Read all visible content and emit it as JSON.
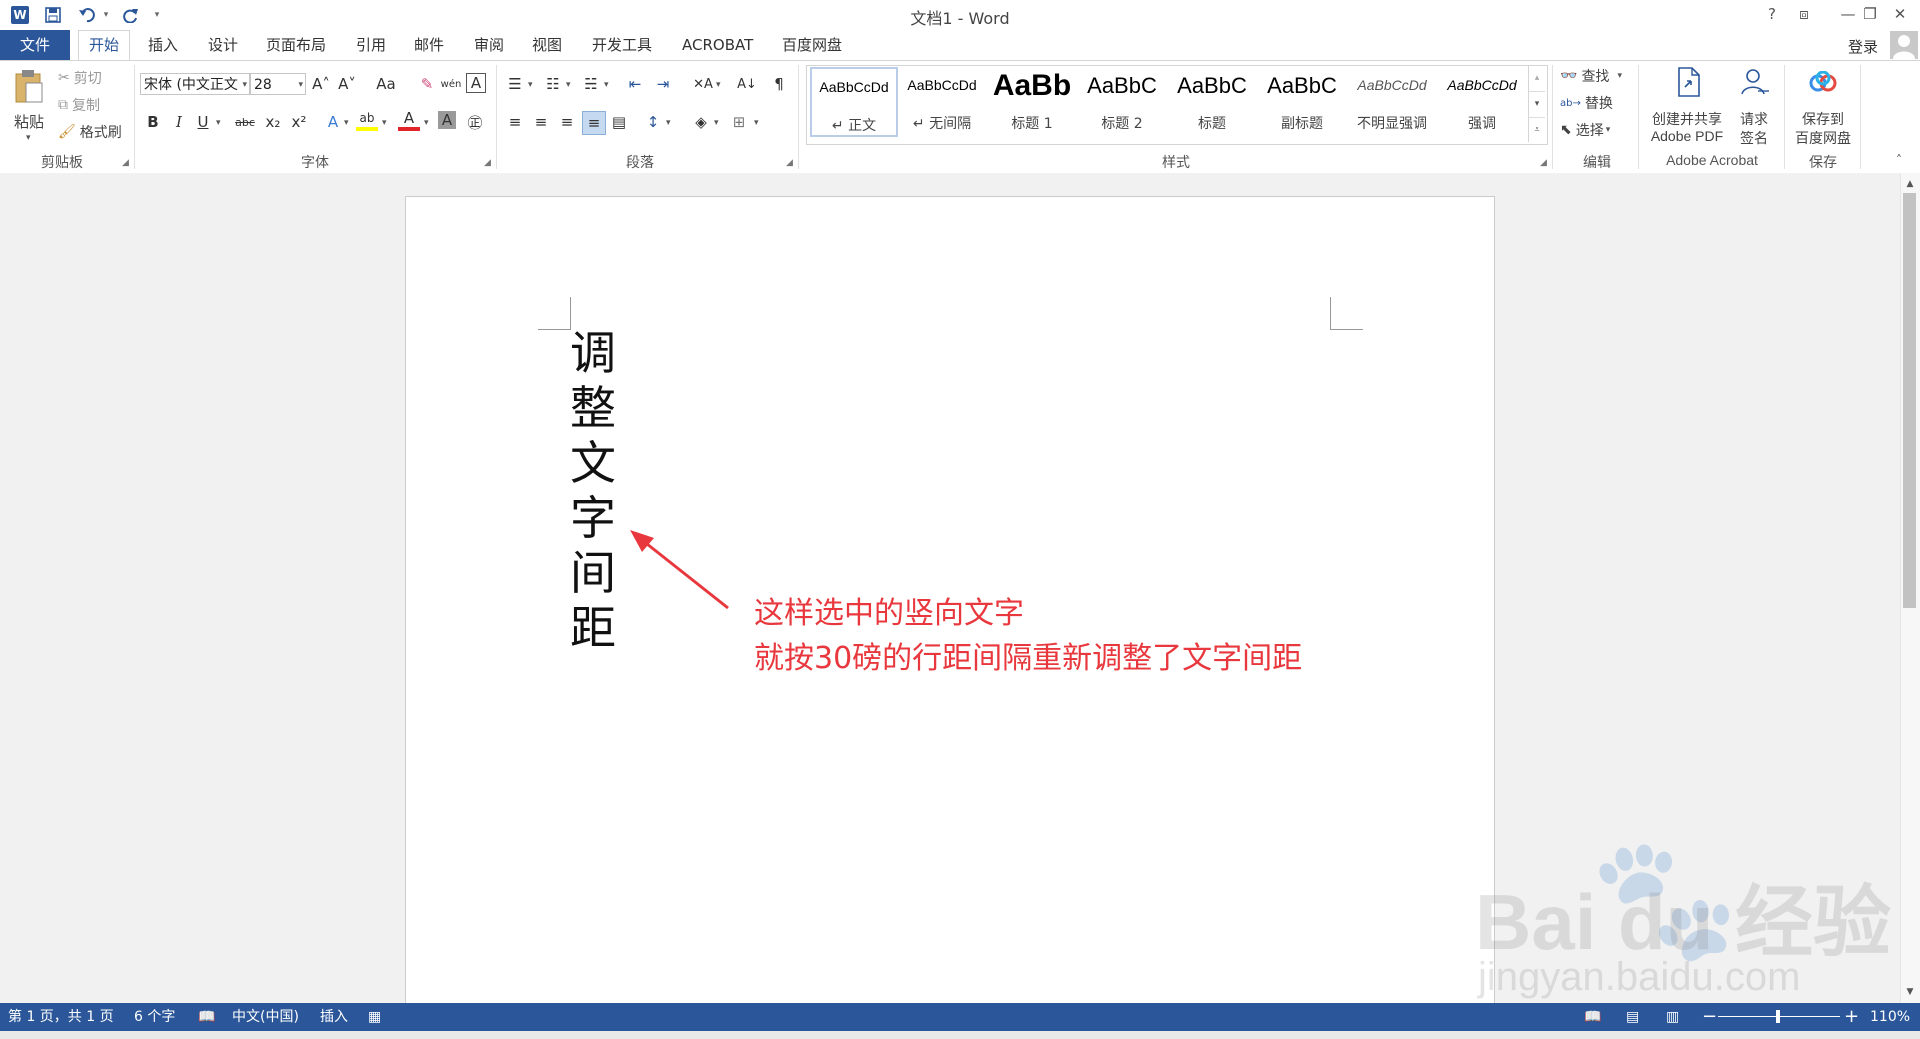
{
  "window": {
    "title": "文档1 - Word",
    "help": "?",
    "ribbon_display": "⧈",
    "minimize": "—",
    "restore": "❐",
    "close": "✕",
    "login": "登录"
  },
  "quick_access": {
    "word_icon": "W",
    "save_icon": "💾",
    "undo_icon": "↶",
    "redo_icon": "↻",
    "customize_icon": "▾"
  },
  "tabs": {
    "file": "文件",
    "home": "开始",
    "insert": "插入",
    "design": "设计",
    "layout": "页面布局",
    "references": "引用",
    "mailings": "邮件",
    "review": "审阅",
    "view": "视图",
    "developer": "开发工具",
    "acrobat": "ACROBAT",
    "baidu": "百度网盘"
  },
  "clipboard": {
    "paste": "粘贴",
    "cut": "剪切",
    "copy": "复制",
    "format_painter": "格式刷",
    "label": "剪贴板"
  },
  "font": {
    "name": "宋体 (中文正文",
    "size": "28",
    "grow": "A˄",
    "shrink": "A˅",
    "case": "Aa",
    "clear": "✎",
    "phonetic": "wén",
    "border": "A",
    "bold": "B",
    "italic": "I",
    "underline": "U",
    "strike": "abc",
    "sub": "x₂",
    "sup": "x²",
    "effects": "A",
    "highlight": "ab",
    "color": "A",
    "shading": "A",
    "enclose": "㊣",
    "label": "字体"
  },
  "paragraph": {
    "bullets": "☰",
    "numbering": "☷",
    "multilevel": "☵",
    "decrease_indent": "⇤",
    "increase_indent": "⇥",
    "chinese_layout": "✕A",
    "sort": "A↓",
    "show_marks": "¶",
    "align_left": "≡",
    "center": "≡",
    "align_right": "≡",
    "justify": "≡",
    "distributed": "▤",
    "line_spacing": "↕",
    "shading": "◈",
    "borders": "⊞",
    "label": "段落"
  },
  "styles": {
    "label": "样式",
    "items": [
      {
        "sample": "AaBbCcDd",
        "name": "↵ 正文"
      },
      {
        "sample": "AaBbCcDd",
        "name": "↵ 无间隔"
      },
      {
        "sample": "AaBb",
        "name": "标题 1"
      },
      {
        "sample": "AaBbC",
        "name": "标题 2"
      },
      {
        "sample": "AaBbC",
        "name": "标题"
      },
      {
        "sample": "AaBbC",
        "name": "副标题"
      },
      {
        "sample": "AaBbCcDd",
        "name": "不明显强调"
      },
      {
        "sample": "AaBbCcDd",
        "name": "强调"
      }
    ]
  },
  "editing": {
    "find": "查找",
    "replace": "替换",
    "select": "选择",
    "label": "编辑"
  },
  "acrobat": {
    "create_line1": "创建并共享",
    "create_line2": "Adobe PDF",
    "sign_line1": "请求",
    "sign_line2": "签名",
    "label": "Adobe Acrobat"
  },
  "save_group": {
    "line1": "保存到",
    "line2": "百度网盘",
    "label": "保存"
  },
  "document": {
    "vertical_chars": [
      "调",
      "整",
      "文",
      "字",
      "间",
      "距"
    ],
    "annotation_line1": "这样选中的竖向文字",
    "annotation_line2": "就按30磅的行距间隔重新调整了文字间距",
    "annotation_color": "#e8383d"
  },
  "status": {
    "page": "第 1 页，共 1 页",
    "words": "6 个字",
    "language": "中文(中国)",
    "mode": "插入",
    "zoom": "110%",
    "zoom_minus": "−",
    "zoom_plus": "+"
  },
  "watermark": {
    "text": "Bai du 经验",
    "url": "jingyan.baidu.com"
  },
  "colors": {
    "accent": "#2b579a",
    "annotation": "#e8383d"
  }
}
